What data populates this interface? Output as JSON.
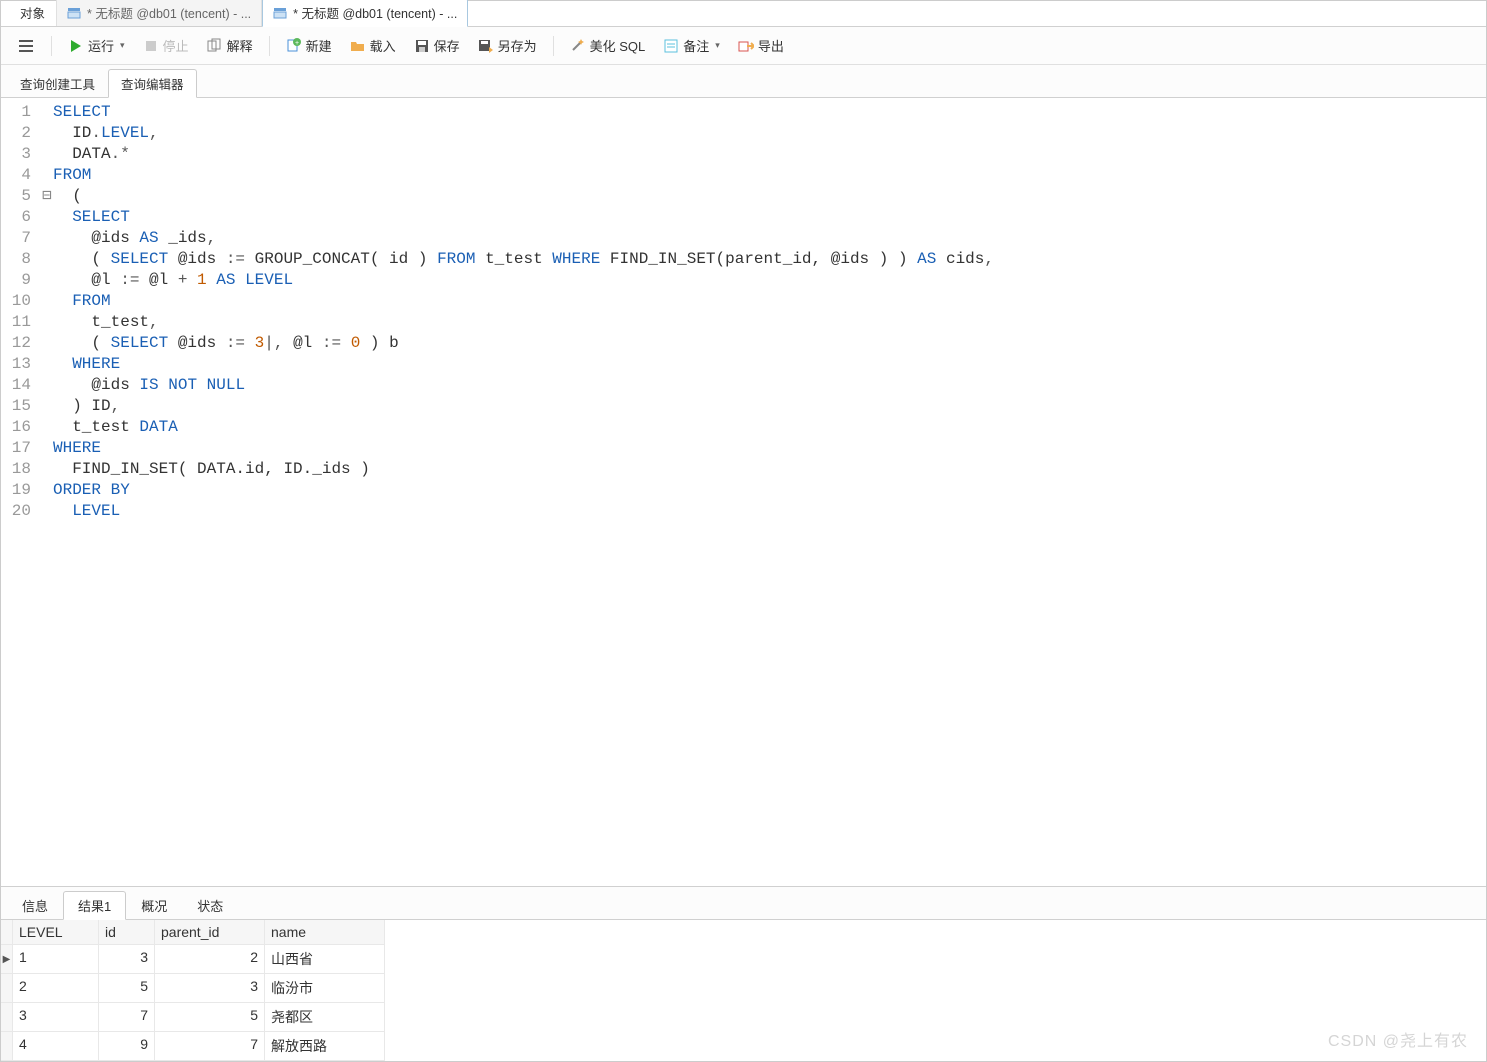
{
  "top_tabs": {
    "objects": "对象",
    "tab1": "* 无标题 @db01 (tencent) - ...",
    "tab2": "* 无标题 @db01 (tencent) - ..."
  },
  "toolbar": {
    "run": "运行",
    "stop": "停止",
    "explain": "解释",
    "new": "新建",
    "load": "载入",
    "save": "保存",
    "save_as": "另存为",
    "beautify": "美化 SQL",
    "comment": "备注",
    "export": "导出"
  },
  "subtabs": {
    "builder": "查询创建工具",
    "editor": "查询编辑器"
  },
  "code": {
    "lines": [
      {
        "n": 1,
        "t": [
          [
            "kw",
            "SELECT"
          ]
        ]
      },
      {
        "n": 2,
        "t": [
          [
            "",
            "  ID"
          ],
          [
            "sym",
            "."
          ],
          [
            "kw",
            "LEVEL"
          ],
          [
            "sym",
            ","
          ]
        ]
      },
      {
        "n": 3,
        "t": [
          [
            "",
            "  DATA"
          ],
          [
            "sym",
            ".*"
          ]
        ]
      },
      {
        "n": 4,
        "t": [
          [
            "kw",
            "FROM"
          ]
        ]
      },
      {
        "n": 5,
        "fold": "-",
        "t": [
          [
            "",
            "  ("
          ]
        ]
      },
      {
        "n": 6,
        "t": [
          [
            "",
            "  "
          ],
          [
            "kw",
            "SELECT"
          ]
        ]
      },
      {
        "n": 7,
        "t": [
          [
            "",
            "    @ids "
          ],
          [
            "kw",
            "AS"
          ],
          [
            "",
            " _ids"
          ],
          [
            "sym",
            ","
          ]
        ]
      },
      {
        "n": 8,
        "t": [
          [
            "",
            "    ( "
          ],
          [
            "kw",
            "SELECT"
          ],
          [
            "",
            " @ids "
          ],
          [
            "sym",
            ":="
          ],
          [
            "",
            " GROUP_CONCAT( id ) "
          ],
          [
            "kw",
            "FROM"
          ],
          [
            "",
            " t_test "
          ],
          [
            "kw",
            "WHERE"
          ],
          [
            "",
            " FIND_IN_SET(parent_id, @ids ) ) "
          ],
          [
            "kw",
            "AS"
          ],
          [
            "",
            " cids"
          ],
          [
            "sym",
            ","
          ]
        ]
      },
      {
        "n": 9,
        "t": [
          [
            "",
            "    @l "
          ],
          [
            "sym",
            ":="
          ],
          [
            "",
            " @l "
          ],
          [
            "sym",
            "+"
          ],
          [
            "",
            " "
          ],
          [
            "num",
            "1"
          ],
          [
            "",
            " "
          ],
          [
            "kw",
            "AS"
          ],
          [
            "",
            " "
          ],
          [
            "kw",
            "LEVEL"
          ]
        ]
      },
      {
        "n": 10,
        "t": [
          [
            "",
            "  "
          ],
          [
            "kw",
            "FROM"
          ]
        ]
      },
      {
        "n": 11,
        "t": [
          [
            "",
            "    t_test"
          ],
          [
            "sym",
            ","
          ]
        ]
      },
      {
        "n": 12,
        "t": [
          [
            "",
            "    ( "
          ],
          [
            "kw",
            "SELECT"
          ],
          [
            "",
            " @ids "
          ],
          [
            "sym",
            ":="
          ],
          [
            "",
            " "
          ],
          [
            "num",
            "3"
          ],
          [
            "sym",
            "|"
          ],
          [
            "sym",
            ","
          ],
          [
            "",
            " @l "
          ],
          [
            "sym",
            ":="
          ],
          [
            "",
            " "
          ],
          [
            "num",
            "0"
          ],
          [
            "",
            " ) b"
          ]
        ]
      },
      {
        "n": 13,
        "t": [
          [
            "",
            "  "
          ],
          [
            "kw",
            "WHERE"
          ]
        ]
      },
      {
        "n": 14,
        "t": [
          [
            "",
            "    @ids "
          ],
          [
            "kw",
            "IS"
          ],
          [
            "",
            " "
          ],
          [
            "kw",
            "NOT"
          ],
          [
            "",
            " "
          ],
          [
            "kw",
            "NULL"
          ]
        ]
      },
      {
        "n": 15,
        "t": [
          [
            "",
            "  ) ID"
          ],
          [
            "sym",
            ","
          ]
        ]
      },
      {
        "n": 16,
        "t": [
          [
            "",
            "  t_test "
          ],
          [
            "kw",
            "DATA"
          ]
        ]
      },
      {
        "n": 17,
        "t": [
          [
            "kw",
            "WHERE"
          ]
        ]
      },
      {
        "n": 18,
        "t": [
          [
            "",
            "  FIND_IN_SET( DATA.id, ID._ids )"
          ]
        ]
      },
      {
        "n": 19,
        "t": [
          [
            "kw",
            "ORDER BY"
          ]
        ]
      },
      {
        "n": 20,
        "t": [
          [
            "",
            "  "
          ],
          [
            "kw",
            "LEVEL"
          ]
        ]
      }
    ]
  },
  "result_tabs": {
    "info": "信息",
    "result1": "结果1",
    "profile": "概况",
    "status": "状态"
  },
  "grid": {
    "cols": {
      "level": "LEVEL",
      "id": "id",
      "pid": "parent_id",
      "name": "name"
    },
    "rows": [
      {
        "level": "1",
        "id": "3",
        "pid": "2",
        "name": "山西省",
        "current": true
      },
      {
        "level": "2",
        "id": "5",
        "pid": "3",
        "name": "临汾市"
      },
      {
        "level": "3",
        "id": "7",
        "pid": "5",
        "name": "尧都区"
      },
      {
        "level": "4",
        "id": "9",
        "pid": "7",
        "name": "解放西路"
      }
    ]
  },
  "watermark": "CSDN @尧上有农"
}
